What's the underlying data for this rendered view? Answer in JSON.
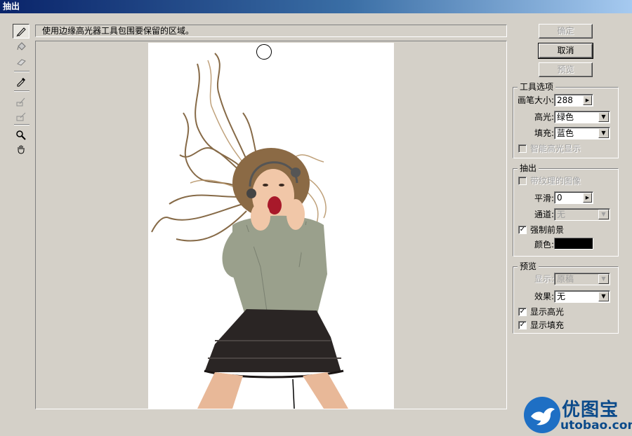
{
  "window": {
    "title": "抽出"
  },
  "hint": {
    "text": "使用边缘高光器工具包围要保留的区域。"
  },
  "tools": [
    {
      "name": "edge-highlighter-icon",
      "active": true
    },
    {
      "name": "fill-bucket-icon",
      "active": false
    },
    {
      "name": "eraser-icon",
      "active": false
    },
    {
      "name": "eyedropper-icon",
      "active": false
    },
    {
      "name": "cleanup-tool-icon",
      "active": false
    },
    {
      "name": "edge-touchup-icon",
      "active": false
    },
    {
      "name": "zoom-icon",
      "active": false
    },
    {
      "name": "hand-icon",
      "active": false
    }
  ],
  "buttons": {
    "ok": "确定",
    "cancel": "取消",
    "preview": "预览"
  },
  "tool_options": {
    "title": "工具选项",
    "brush_size_label": "画笔大小:",
    "brush_size_value": "288",
    "highlight_label": "高光:",
    "highlight_value": "绿色",
    "fill_label": "填充:",
    "fill_value": "蓝色",
    "smart_highlight_label": "智能高光显示",
    "smart_highlight_checked": false
  },
  "extraction": {
    "title": "抽出",
    "textured_image_label": "带纹理的图像",
    "textured_image_checked": false,
    "smooth_label": "平滑:",
    "smooth_value": "0",
    "channel_label": "通道:",
    "channel_value": "无",
    "force_foreground_label": "强制前景",
    "force_foreground_checked": true,
    "color_label": "颜色:",
    "color_value": "#000000"
  },
  "preview": {
    "title": "预览",
    "show_label": "显示:",
    "show_value": "原稿",
    "effect_label": "效果:",
    "effect_value": "无",
    "show_highlight_label": "显示高光",
    "show_highlight_checked": true,
    "show_fill_label": "显示填充",
    "show_fill_checked": true
  },
  "watermark": {
    "name": "优图宝",
    "url": "utobao.com"
  },
  "colors": {
    "title_start": "#0a246a",
    "title_end": "#a6caf0",
    "face": "#d4d0c8",
    "watermark": "#0b4a8a"
  }
}
